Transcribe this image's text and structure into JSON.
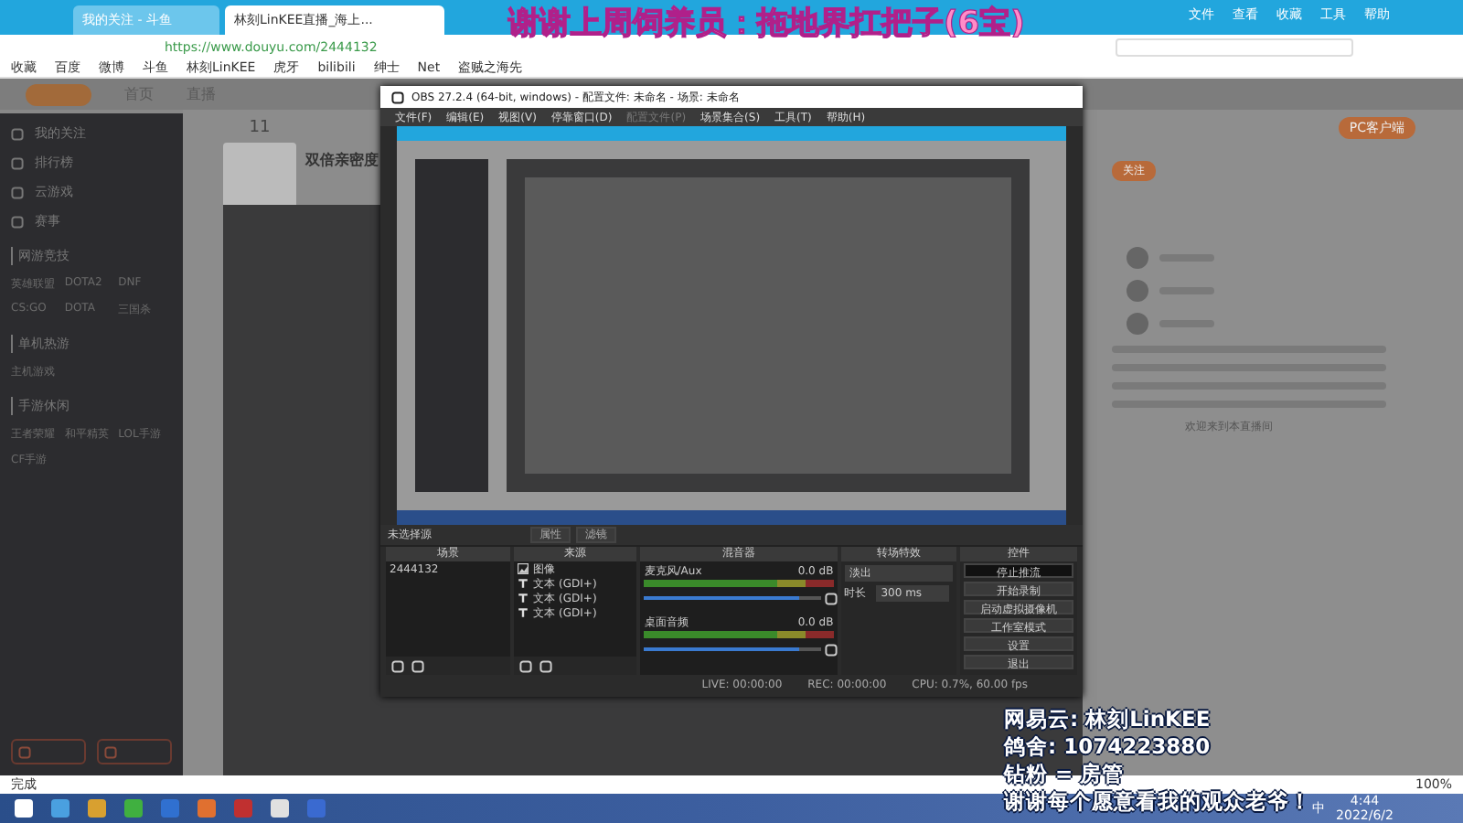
{
  "overlay_top": "谢谢上周饲养员：拖地界扛把子(6宝)",
  "browser": {
    "tabs": [
      {
        "label": "我的关注 - 斗鱼",
        "selected": false
      },
      {
        "label": "林刻LinKEE直播_海上...",
        "selected": true
      }
    ],
    "url": "https://www.douyu.com/2444132",
    "menu": [
      "文件",
      "查看",
      "收藏",
      "工具",
      "帮助"
    ],
    "bookmarks": [
      "收藏",
      "百度",
      "微博",
      "斗鱼",
      "林刻LinKEE",
      "虎牙",
      "bilibili",
      "绅士",
      "Net",
      "盗贼之海先"
    ],
    "status": "完成",
    "zoom": "100%"
  },
  "site": {
    "nav": [
      "首页",
      "直播"
    ],
    "sidebar": {
      "items": [
        "我的关注",
        "排行榜",
        "云游戏",
        "赛事"
      ],
      "sections": [
        {
          "title": "网游竞技",
          "items": [
            "英雄联盟",
            "DOTA2",
            "DNF",
            "CS:GO",
            "DOTA",
            "三国杀"
          ]
        },
        {
          "title": "单机热游",
          "items": [
            "主机游戏"
          ]
        },
        {
          "title": "手游休闲",
          "items": [
            "王者荣耀",
            "和平精英",
            "LOL手游",
            "CF手游"
          ]
        }
      ]
    },
    "stat": "11",
    "room_title": "双倍亲密度",
    "client_button": "PC客户端",
    "follow": "关注",
    "welcome": "欢迎来到本直播间"
  },
  "obs": {
    "title": "OBS 27.2.4 (64-bit, windows) - 配置文件: 未命名 - 场景: 未命名",
    "menu": [
      {
        "label": "文件(F)",
        "disabled": false
      },
      {
        "label": "编辑(E)",
        "disabled": false
      },
      {
        "label": "视图(V)",
        "disabled": false
      },
      {
        "label": "停靠窗口(D)",
        "disabled": false
      },
      {
        "label": "配置文件(P)",
        "disabled": true
      },
      {
        "label": "场景集合(S)",
        "disabled": false
      },
      {
        "label": "工具(T)",
        "disabled": false
      },
      {
        "label": "帮助(H)",
        "disabled": false
      }
    ],
    "no_source": "未选择源",
    "tools": [
      "属性",
      "滤镜"
    ],
    "scenes": {
      "title": "场景",
      "items": [
        {
          "label": "2444132",
          "selected": false
        }
      ]
    },
    "sources": {
      "title": "来源",
      "items": [
        {
          "kind": "image",
          "label": "图像"
        },
        {
          "kind": "text",
          "label": "文本 (GDI+)"
        },
        {
          "kind": "text",
          "label": "文本 (GDI+)"
        },
        {
          "kind": "text",
          "label": "文本 (GDI+)"
        }
      ]
    },
    "mixer": {
      "title": "混音器",
      "channels": [
        {
          "name": "麦克风/Aux",
          "reading": "0.0 dB",
          "level": 0.88
        },
        {
          "name": "桌面音频",
          "reading": "0.0 dB",
          "level": 0.88
        }
      ]
    },
    "transitions": {
      "title": "转场特效",
      "type": "淡出",
      "duration_label": "时长",
      "duration": "300 ms"
    },
    "controls": {
      "title": "控件",
      "buttons": [
        {
          "label": "停止推流",
          "active": true
        },
        {
          "label": "开始录制",
          "active": false
        },
        {
          "label": "启动虚拟摄像机",
          "active": false
        },
        {
          "label": "工作室模式",
          "active": false
        },
        {
          "label": "设置",
          "active": false
        },
        {
          "label": "退出",
          "active": false
        }
      ]
    },
    "status": [
      "LIVE: 00:00:00",
      "REC: 00:00:00",
      "CPU: 0.7%, 60.00 fps"
    ]
  },
  "overlay_bottom": [
    "网易云: 林刻LinKEE",
    "鸽舍: 1074223880",
    "钻粉 = 房管",
    "谢谢每个愿意看我的观众老爷！"
  ],
  "taskbar": {
    "ime": "中",
    "time": "4:44",
    "date": "2022/6/2"
  }
}
